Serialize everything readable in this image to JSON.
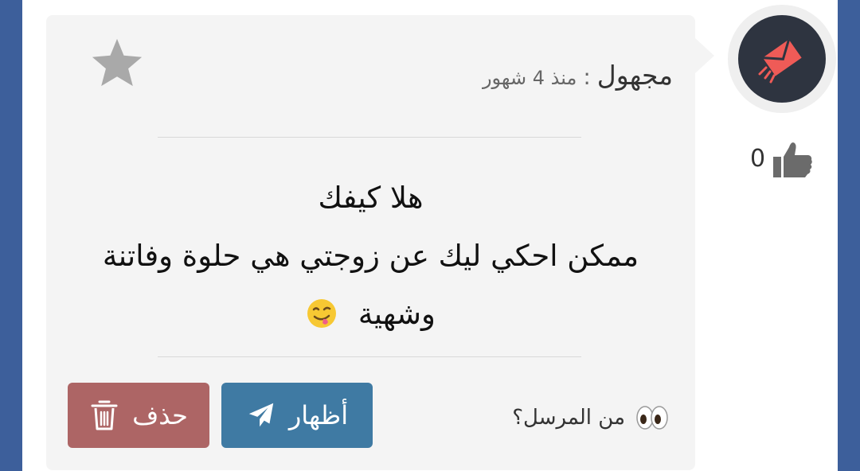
{
  "message_card": {
    "sender": "مجهول",
    "separator": ":",
    "time": "منذ 4 شهور",
    "lines": [
      "هلا كيفك",
      "ممكن احكي ليك عن زوجتي هي حلوة وفاتنة",
      "وشهية"
    ],
    "question": "من المرسل؟",
    "buttons": {
      "show": "أظهار",
      "delete": "حذف"
    }
  },
  "likes": {
    "count": "0"
  },
  "colors": {
    "page_background": "#3d5f9b",
    "card_background": "#f4f4f4",
    "avatar_background": "#2e3440",
    "accent_red": "#ef5b57",
    "show_button": "#3f7aa3",
    "delete_button": "#ad6565"
  },
  "icons": {
    "star": "star-icon",
    "avatar": "envelope-icon",
    "like": "thumbs-up-icon",
    "emoji": "face-savoring-food-icon",
    "question": "eyes-icon",
    "show": "paper-plane-icon",
    "delete": "trash-icon"
  }
}
